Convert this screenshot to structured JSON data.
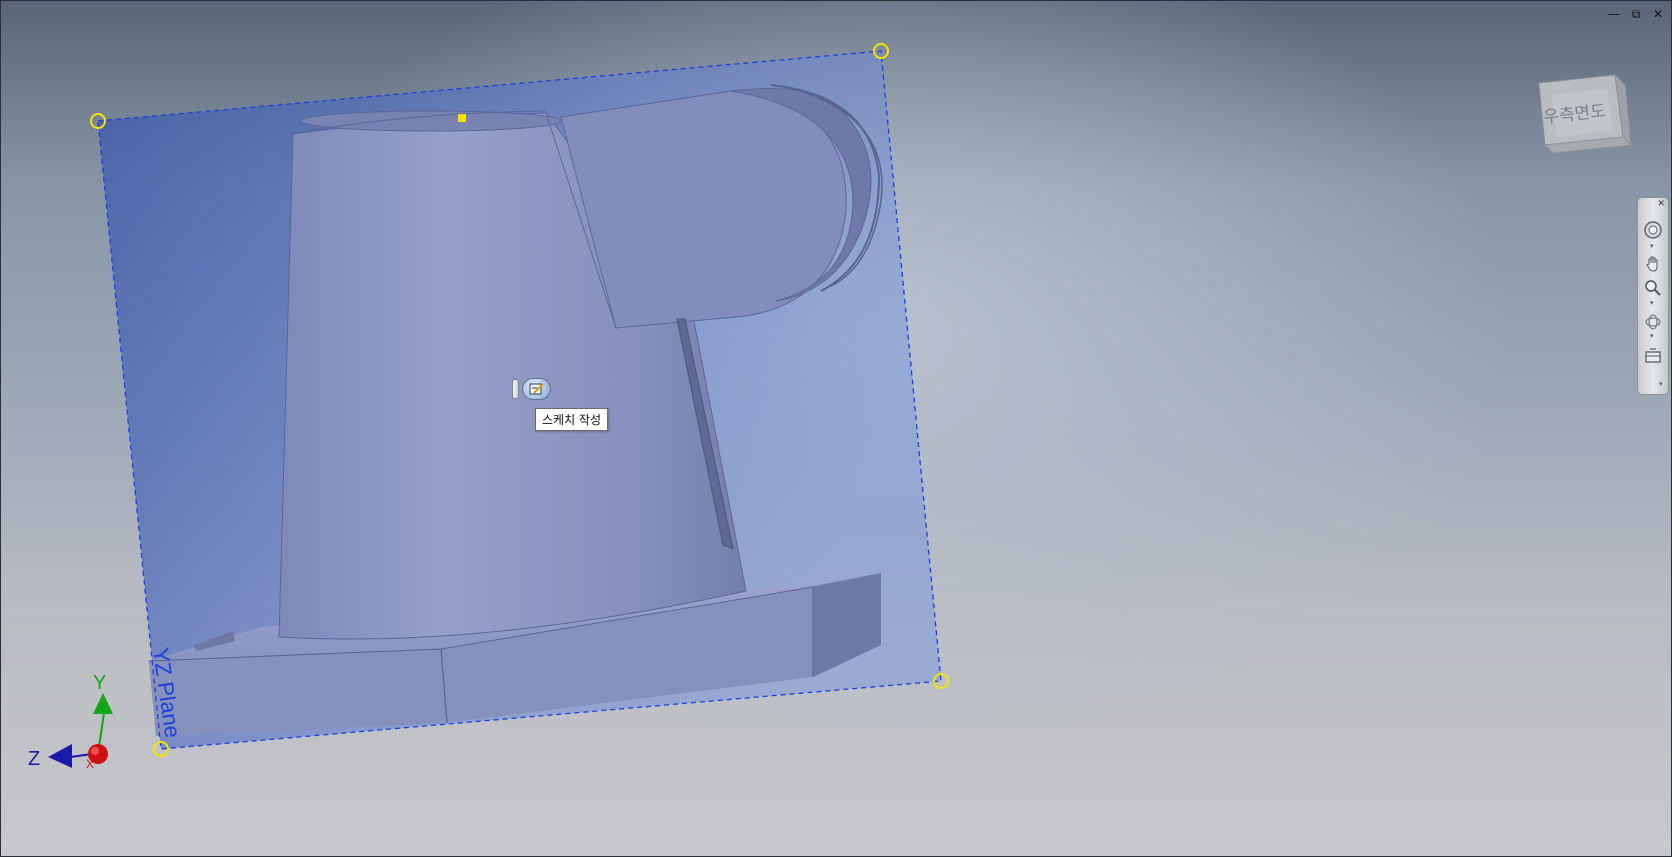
{
  "window": {
    "controls": [
      "minimize",
      "restore",
      "close"
    ]
  },
  "viewcube": {
    "face_label": "우측면도"
  },
  "plane": {
    "label": "YZ Plane"
  },
  "triad": {
    "y_label": "Y",
    "z_label": "Z",
    "x_label": "X"
  },
  "minitoolbar": {
    "button_icon": "create-sketch-icon"
  },
  "tooltip": {
    "text": "스케치 작성"
  },
  "navbar": {
    "items": [
      "steering-wheel-icon",
      "pan-icon",
      "zoom-icon",
      "orbit-icon",
      "look-at-icon"
    ]
  },
  "colors": {
    "plane_fill": "#5d78c8",
    "plane_border": "#1b3fe0",
    "handle": "#f2e400",
    "model": "#8d97c2",
    "axis_y": "#14a614",
    "axis_z": "#1a1aa8",
    "axis_x": "#cc1010"
  }
}
